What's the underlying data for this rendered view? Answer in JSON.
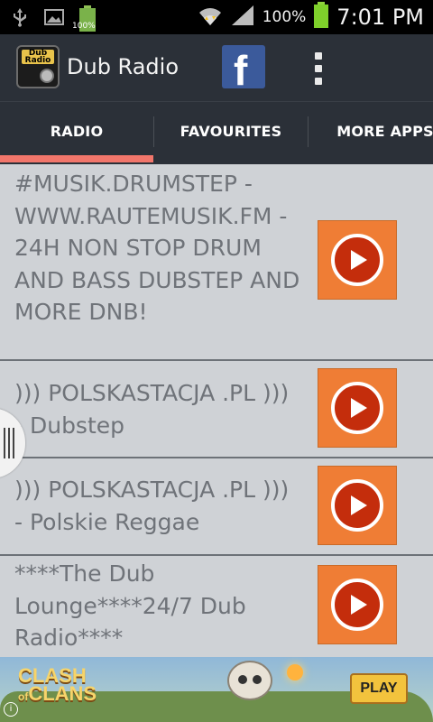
{
  "status_bar": {
    "battery_small_label": "100%",
    "battery_percent": "100%",
    "time": "7:01 PM"
  },
  "app": {
    "icon_text": "Dub Radio",
    "title": "Dub Radio",
    "facebook_label": "f"
  },
  "tabs": [
    {
      "label": "RADIO",
      "selected": true
    },
    {
      "label": "FAVOURITES",
      "selected": false
    },
    {
      "label": "MORE APPS",
      "selected": false
    }
  ],
  "stations": [
    {
      "name": "#MUSIK.DRUMSTEP - WWW.RAUTEMUSIK.FM - 24H NON STOP DRUM AND BASS DUBSTEP AND MORE DNB!"
    },
    {
      "name": "))) POLSKASTACJA .PL ))) - Dubstep"
    },
    {
      "name": "))) POLSKASTACJA .PL ))) - Polskie Reggae"
    },
    {
      "name": "****The Dub Lounge****24/7 Dub Radio****"
    }
  ],
  "ad": {
    "logo_line1": "CLASH",
    "logo_line2": "CLANS",
    "logo_of": "of",
    "play_label": "PLAY",
    "info_label": "i"
  },
  "colors": {
    "action_bar": "#2b3038",
    "tab_indicator": "#f2766b",
    "play_button": "#ef7d35",
    "list_background": "#cfd2d6"
  },
  "icons": {
    "status": [
      "usb-icon",
      "image-icon",
      "battery-small-icon",
      "wifi-icon",
      "signal-icon",
      "battery-icon"
    ],
    "overflow": "overflow-menu-icon",
    "play": "play-icon"
  }
}
